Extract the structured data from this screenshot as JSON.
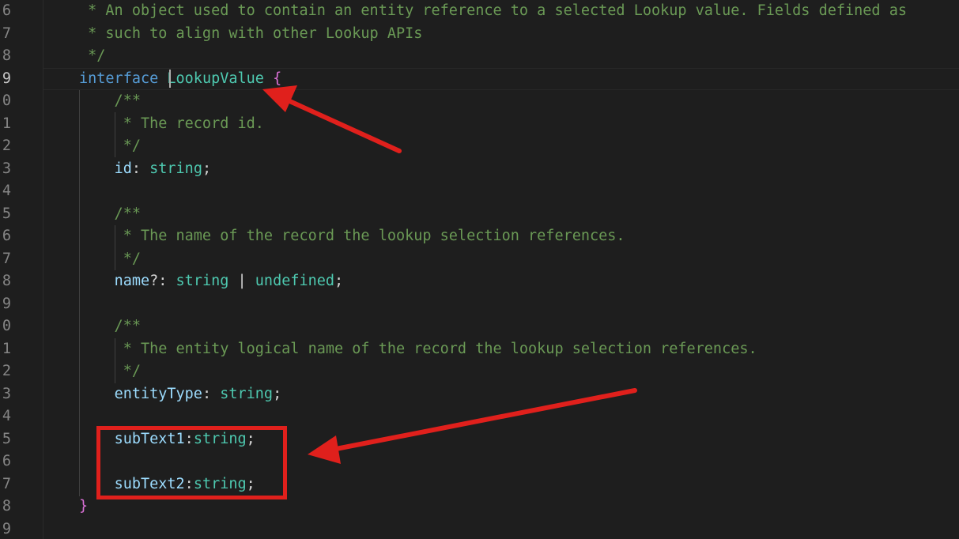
{
  "editor": {
    "line_numbers": [
      "6",
      "7",
      "8",
      "9",
      "0",
      "1",
      "2",
      "3",
      "4",
      "5",
      "6",
      "7",
      "8",
      "9",
      "0",
      "1",
      "2",
      "3",
      "4",
      "5",
      "6",
      "7",
      "8",
      "9"
    ],
    "active_line_number": "9",
    "lines": [
      {
        "parts": [
          {
            "t": " * An object used to contain an entity reference to a selected Lookup value. Fields defined as",
            "c": "comment"
          }
        ]
      },
      {
        "parts": [
          {
            "t": " * such to align with other Lookup APIs",
            "c": "comment"
          }
        ]
      },
      {
        "parts": [
          {
            "t": " */",
            "c": "comment"
          }
        ]
      },
      {
        "parts": [
          {
            "t": "interface",
            "c": "kw"
          },
          {
            "t": " ",
            "c": "punct"
          },
          {
            "t": "LookupValue",
            "c": "type-name"
          },
          {
            "t": " ",
            "c": "punct"
          },
          {
            "t": "{",
            "c": "brace"
          }
        ]
      },
      {
        "parts": [
          {
            "t": "    /**",
            "c": "comment"
          }
        ]
      },
      {
        "parts": [
          {
            "t": "     * The record id.",
            "c": "comment"
          }
        ]
      },
      {
        "parts": [
          {
            "t": "     */",
            "c": "comment"
          }
        ]
      },
      {
        "parts": [
          {
            "t": "    ",
            "c": "punct"
          },
          {
            "t": "id",
            "c": "prop"
          },
          {
            "t": ": ",
            "c": "punct"
          },
          {
            "t": "string",
            "c": "type-name"
          },
          {
            "t": ";",
            "c": "punct"
          }
        ]
      },
      {
        "parts": []
      },
      {
        "parts": [
          {
            "t": "    /**",
            "c": "comment"
          }
        ]
      },
      {
        "parts": [
          {
            "t": "     * The name of the record the lookup selection references.",
            "c": "comment"
          }
        ]
      },
      {
        "parts": [
          {
            "t": "     */",
            "c": "comment"
          }
        ]
      },
      {
        "parts": [
          {
            "t": "    ",
            "c": "punct"
          },
          {
            "t": "name",
            "c": "prop"
          },
          {
            "t": "?: ",
            "c": "punct"
          },
          {
            "t": "string",
            "c": "type-name"
          },
          {
            "t": " | ",
            "c": "punct"
          },
          {
            "t": "undefined",
            "c": "type-name"
          },
          {
            "t": ";",
            "c": "punct"
          }
        ]
      },
      {
        "parts": []
      },
      {
        "parts": [
          {
            "t": "    /**",
            "c": "comment"
          }
        ]
      },
      {
        "parts": [
          {
            "t": "     * The entity logical name of the record the lookup selection references.",
            "c": "comment"
          }
        ]
      },
      {
        "parts": [
          {
            "t": "     */",
            "c": "comment"
          }
        ]
      },
      {
        "parts": [
          {
            "t": "    ",
            "c": "punct"
          },
          {
            "t": "entityType",
            "c": "prop"
          },
          {
            "t": ": ",
            "c": "punct"
          },
          {
            "t": "string",
            "c": "type-name"
          },
          {
            "t": ";",
            "c": "punct"
          }
        ]
      },
      {
        "parts": []
      },
      {
        "parts": [
          {
            "t": "    ",
            "c": "punct"
          },
          {
            "t": "subText1",
            "c": "prop"
          },
          {
            "t": ":",
            "c": "punct"
          },
          {
            "t": "string",
            "c": "type-name"
          },
          {
            "t": ";",
            "c": "punct"
          }
        ]
      },
      {
        "parts": []
      },
      {
        "parts": [
          {
            "t": "    ",
            "c": "punct"
          },
          {
            "t": "subText2",
            "c": "prop"
          },
          {
            "t": ":",
            "c": "punct"
          },
          {
            "t": "string",
            "c": "type-name"
          },
          {
            "t": ";",
            "c": "punct"
          }
        ]
      },
      {
        "parts": [
          {
            "t": "}",
            "c": "brace"
          }
        ]
      },
      {
        "parts": []
      }
    ]
  },
  "annotation_color": "#e0201c"
}
